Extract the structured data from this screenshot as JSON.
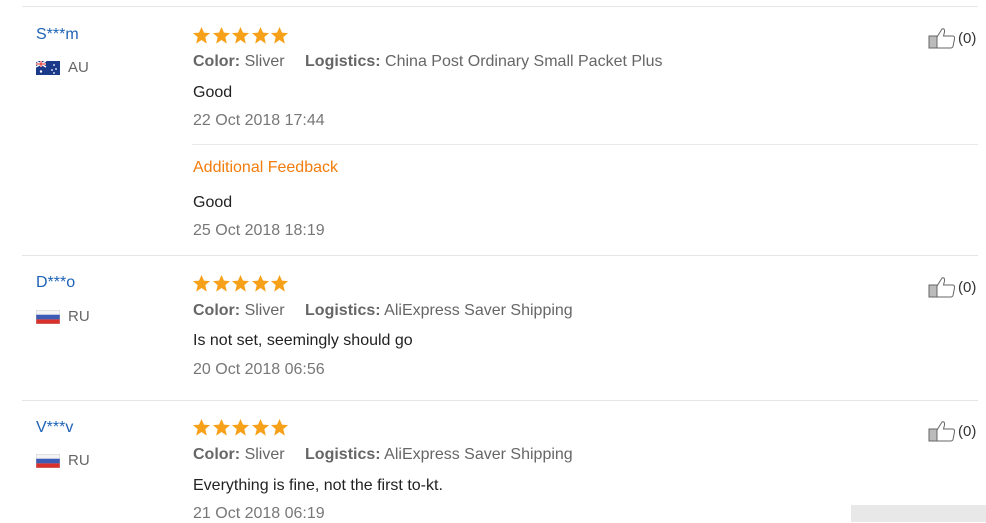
{
  "reviews": [
    {
      "user": "S***m",
      "country": "AU",
      "flag": "australia-flag-icon",
      "rating": 5,
      "color_label": "Color:",
      "color_value": "Sliver",
      "logistics_label": "Logistics:",
      "logistics_value": "China Post Ordinary Small Packet Plus",
      "text": "Good",
      "date": "22 Oct 2018 17:44",
      "additional_title": "Additional Feedback",
      "additional_text": "Good",
      "additional_date": "25 Oct 2018 18:19",
      "likes": "(0)"
    },
    {
      "user": "D***o",
      "country": "RU",
      "flag": "russia-flag-icon",
      "rating": 5,
      "color_label": "Color:",
      "color_value": "Sliver",
      "logistics_label": "Logistics:",
      "logistics_value": "AliExpress Saver Shipping",
      "text": "Is not set, seemingly should go",
      "date": "20 Oct 2018 06:56",
      "likes": "(0)"
    },
    {
      "user": "V***v",
      "country": "RU",
      "flag": "russia-flag-icon",
      "rating": 5,
      "color_label": "Color:",
      "color_value": "Sliver",
      "logistics_label": "Logistics:",
      "logistics_value": "AliExpress Saver Shipping",
      "text": "Everything is fine, not the first to-kt.",
      "date": "21 Oct 2018 06:19",
      "likes": "(0)"
    }
  ],
  "colors": {
    "star": "#f7a11a",
    "user_link": "#1e63b5",
    "additional": "#f27c0c"
  }
}
